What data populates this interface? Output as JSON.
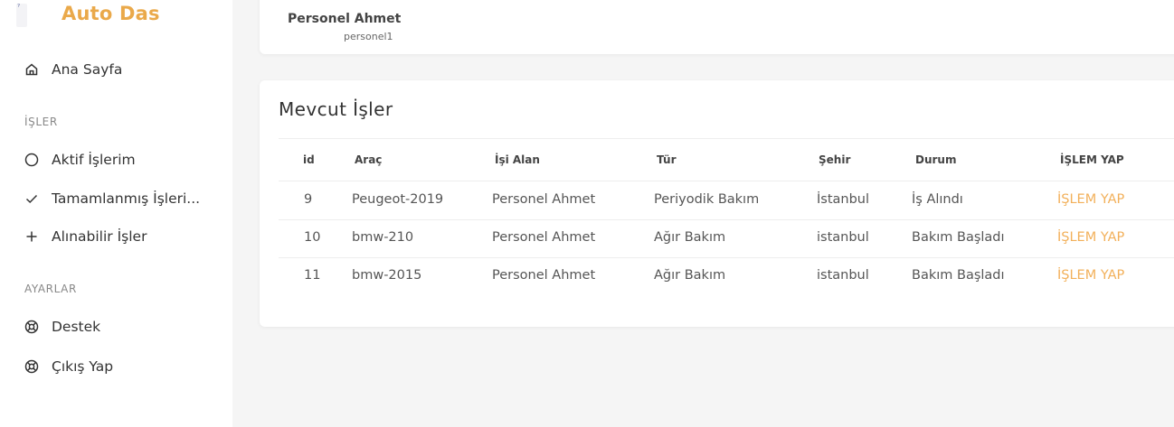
{
  "brand": {
    "name": "Auto Das",
    "logo_mark": "⁷"
  },
  "sidebar": {
    "home": {
      "label": "Ana Sayfa",
      "icon": "home-icon"
    },
    "section_jobs": "İŞLER",
    "jobs_items": [
      {
        "label": "Aktif İşlerim",
        "icon": "circle-icon"
      },
      {
        "label": "Tamamlanmış İşleri...",
        "icon": "check-icon"
      },
      {
        "label": "Alınabilir İşler",
        "icon": "plus-icon"
      }
    ],
    "section_settings": "AYARLAR",
    "settings_items": [
      {
        "label": "Destek",
        "icon": "lifebuoy-icon"
      },
      {
        "label": "Çıkış Yap",
        "icon": "lifebuoy-icon"
      }
    ]
  },
  "user": {
    "name": "Personel Ahmet",
    "username": "personel1"
  },
  "jobs": {
    "title": "Mevcut İşler",
    "columns": [
      "id",
      "Araç",
      "İşi Alan",
      "Tür",
      "Şehir",
      "Durum",
      "İŞLEM YAP"
    ],
    "rows": [
      {
        "id": "9",
        "vehicle": "Peugeot-2019",
        "assignee": "Personel Ahmet",
        "type": "Periyodik Bakım",
        "city": "İstanbul",
        "status": "İş Alındı",
        "action": "İŞLEM YAP"
      },
      {
        "id": "10",
        "vehicle": "bmw-210",
        "assignee": "Personel Ahmet",
        "type": "Ağır Bakım",
        "city": "istanbul",
        "status": "Bakım Başladı",
        "action": "İŞLEM YAP"
      },
      {
        "id": "11",
        "vehicle": "bmw-2015",
        "assignee": "Personel Ahmet",
        "type": "Ağır Bakım",
        "city": "istanbul",
        "status": "Bakım Başladı",
        "action": "İŞLEM YAP"
      }
    ]
  },
  "colors": {
    "accent": "#eaa94a",
    "action": "#f2b05a",
    "background": "#f5f5f5"
  }
}
